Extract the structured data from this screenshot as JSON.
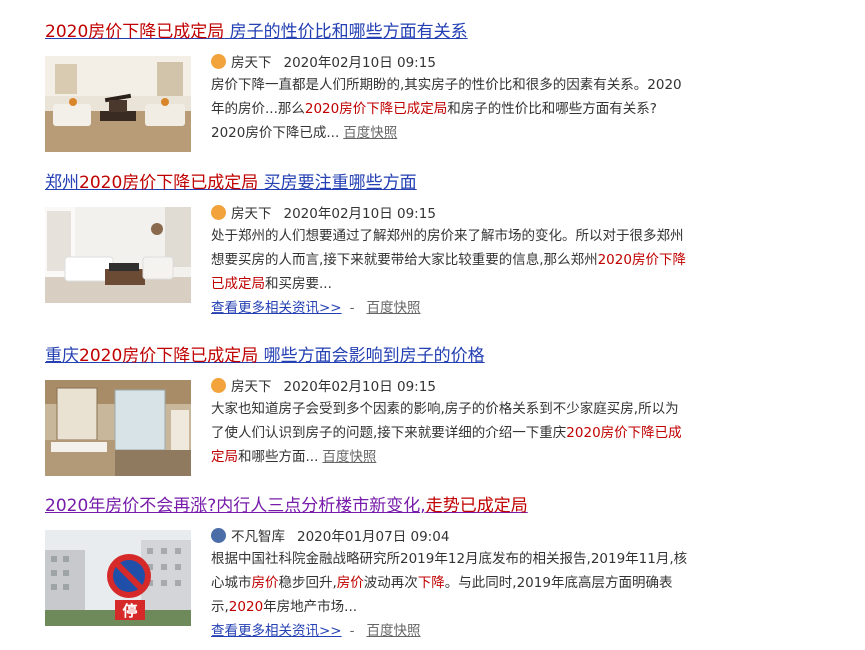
{
  "results": [
    {
      "title_pre": "2020房价下降已成定局",
      "title_post": " 房子的性价比和哪些方面有关系",
      "source": "房天下",
      "date": "2020年02月10日 09:15",
      "abstract_pre": "房价下降一直都是人们所期盼的,其实房子的性价比和很多的因素有关系。2020年的房价...那么",
      "abstract_em": "2020房价下降已成定局",
      "abstract_post": "和房子的性价比和哪些方面有关系? 2020房价下降已成...",
      "snapshot": "百度快照",
      "source_icon": "house-icon",
      "colors": {
        "icon": "#f2a33c"
      }
    },
    {
      "title_pre": "郑州",
      "title_em": "2020房价下降已成定局",
      "title_post": " 买房要注重哪些方面",
      "source": "房天下",
      "date": "2020年02月10日 09:15",
      "abstract_pre": "处于郑州的人们想要通过了解郑州的房价来了解市场的变化。所以对于很多郑州想要买房的人而言,接下来就要带给大家比较重要的信息,那么郑州",
      "abstract_em": "2020房价下降已成定局",
      "abstract_post": "和买房要...",
      "more_link": "查看更多相关资讯>>",
      "separator": "-",
      "snapshot": "百度快照"
    },
    {
      "title_pre": "重庆",
      "title_em": "2020房价下降已成定局",
      "title_post": " 哪些方面会影响到房子的价格",
      "source": "房天下",
      "date": "2020年02月10日 09:15",
      "abstract_pre": "大家也知道房子会受到多个因素的影响,房子的价格关系到不少家庭买房,所以为了使人们认识到房子的问题,接下来就要详细的介绍一下重庆",
      "abstract_em": "2020房价下降已成定局",
      "abstract_post": "和哪些方面...",
      "snapshot": "百度快照"
    },
    {
      "title_a": "2020年房价不会再涨?内行人三点分析楼市新变化,",
      "title_b": "走势已成定局",
      "source": "不凡智库",
      "date": "2020年01月07日 09:04",
      "abstract_1": "根据中国社科院金融战略研究所2019年12月底发布的相关报告,2019年11月,核心城市",
      "abstract_em1": "房价",
      "abstract_2": "稳步回升,",
      "abstract_em2": "房价",
      "abstract_3": "波动再次",
      "abstract_em3": "下降",
      "abstract_4": "。与此同时,2019年底高层方面明确表示,",
      "abstract_em4": "2020",
      "abstract_5": "年房地产市场...",
      "thumb_sign": "停",
      "more_link": "查看更多相关资讯>>",
      "separator": "-",
      "snapshot": "百度快照",
      "source_icon": "think-tank-icon",
      "colors": {
        "icon": "#4b6ea8",
        "visited_title": "#771caa"
      }
    }
  ],
  "colors": {
    "link": "#2440b3",
    "highlight": "#c00000",
    "text": "#333333"
  }
}
